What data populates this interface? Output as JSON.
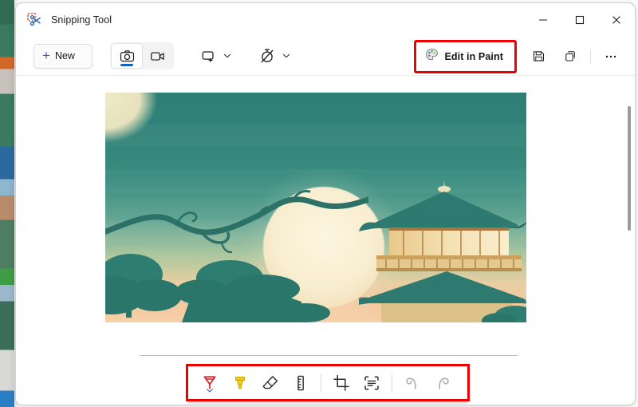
{
  "window": {
    "title": "Snipping Tool",
    "app_icon": "snipping-tool-icon",
    "controls": {
      "minimize": "minimize-icon",
      "maximize": "maximize-icon",
      "close": "close-icon"
    }
  },
  "command_bar": {
    "new_button": {
      "label": "New",
      "plus": "+"
    },
    "modes": [
      {
        "name": "screenshot",
        "icon": "camera-icon",
        "selected": true
      },
      {
        "name": "video",
        "icon": "video-camera-icon",
        "selected": false
      }
    ],
    "snip_mode": {
      "icon": "rectangle-snip-icon",
      "chevron": "chevron-down-icon"
    },
    "delay": {
      "icon": "timer-off-icon",
      "chevron": "chevron-down-icon"
    },
    "edit_in_paint": {
      "label": "Edit in Paint",
      "icon": "paint-palette-icon"
    },
    "save": {
      "icon": "save-floppy-icon"
    },
    "copy": {
      "icon": "copy-icon"
    },
    "more": {
      "icon": "ellipsis-icon"
    }
  },
  "canvas": {
    "preview_alt": "snipped-screenshot-preview",
    "scene": {
      "sky_top_color": "#2e8077",
      "sky_bottom_color": "#f6cfa8",
      "moon_color": "#fdf6e0",
      "pagoda_roof_color": "#2f7a70",
      "pagoda_body_color": "#e8c98b",
      "foliage_color": "#2d7d71"
    },
    "scrollbar": "vertical-scrollbar"
  },
  "tool_bar": {
    "highlight_color": "#ec0000",
    "tools": [
      {
        "name": "ballpoint-pen",
        "icon": "ballpoint-pen-icon",
        "color": "#d61f26",
        "has_chevron": true,
        "disabled": false
      },
      {
        "name": "highlighter",
        "icon": "highlighter-icon",
        "color": "#f3d218",
        "has_chevron": false,
        "disabled": false
      },
      {
        "name": "eraser",
        "icon": "eraser-icon",
        "color": "#2b2b2b",
        "has_chevron": false,
        "disabled": false
      },
      {
        "name": "ruler",
        "icon": "ruler-icon",
        "color": "#2b2b2b",
        "has_chevron": false,
        "disabled": false
      },
      {
        "name": "crop",
        "icon": "crop-icon",
        "color": "#2b2b2b",
        "has_chevron": false,
        "disabled": false
      },
      {
        "name": "text-actions",
        "icon": "text-actions-icon",
        "color": "#2b2b2b",
        "has_chevron": false,
        "disabled": false
      },
      {
        "name": "undo",
        "icon": "undo-icon",
        "color": "#2b2b2b",
        "has_chevron": false,
        "disabled": true
      },
      {
        "name": "redo",
        "icon": "redo-icon",
        "color": "#2b2b2b",
        "has_chevron": false,
        "disabled": true
      }
    ]
  }
}
